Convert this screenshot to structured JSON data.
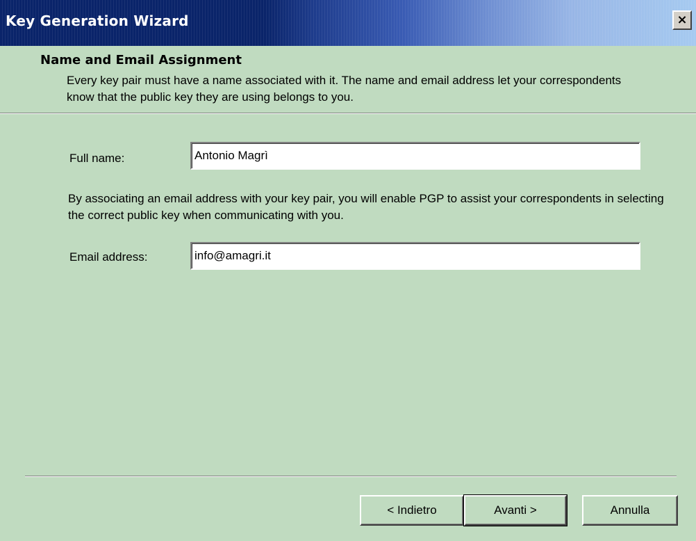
{
  "window": {
    "title": "Key Generation Wizard",
    "close_label": "×"
  },
  "header": {
    "title": "Name and Email Assignment",
    "description": "Every key pair must have a name associated with it.  The name and email address let your correspondents know that the public key they are using belongs to you."
  },
  "form": {
    "full_name_label": "Full name:",
    "full_name_value": "Antonio Magrì",
    "info_text": "By associating an email address with your key pair, you will enable PGP to assist your correspondents in selecting the correct public key when communicating with you.",
    "email_label": "Email address:",
    "email_value": "info@amagri.it"
  },
  "buttons": {
    "back_label": "< Indietro",
    "next_label": "Avanti >",
    "cancel_label": "Annulla"
  },
  "colors": {
    "background": "#c0dbc0",
    "titlebar_start": "#0a246a",
    "titlebar_end": "#a6caf0"
  }
}
